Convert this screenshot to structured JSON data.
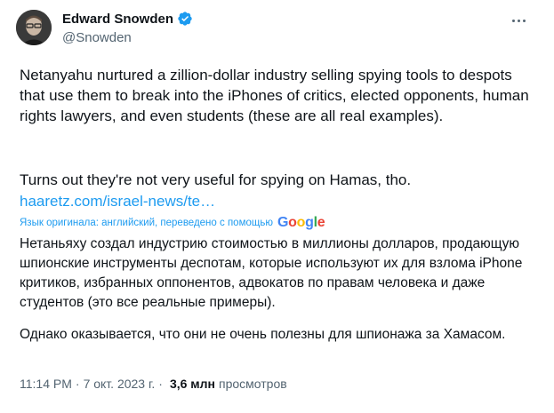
{
  "author": {
    "name": "Edward Snowden",
    "handle": "@Snowden",
    "verified": true,
    "avatar_icon": "person-avatar"
  },
  "menu_icon": "more-horizontal-icon",
  "tweet": {
    "text_p1": "Netanyahu nurtured a zillion-dollar industry selling spying tools to despots that use them to break into the iPhones of critics, elected opponents, human rights lawyers, and even students (these are all real examples).",
    "text_p2": "Turns out they're not very useful for spying on Hamas, tho.",
    "link": "haaretz.com/israel-news/te…"
  },
  "translation": {
    "notice": "Язык оригинала: английский, переведено с помощью",
    "provider": "Google",
    "text_p1": "Нетаньяху создал индустрию стоимостью в миллионы долларов, продающую шпионские инструменты деспотам, которые используют их для взлома iPhone критиков, избранных оппонентов, адвокатов по правам человека и даже студентов (это все реальные примеры).",
    "text_p2": "Однако оказывается, что они не очень полезны для шпионажа за Хамасом."
  },
  "meta": {
    "time": "11:14 PM",
    "separator": "·",
    "date": "7 окт. 2023 г.",
    "views_count": "3,6 млн",
    "views_label": "просмотров"
  },
  "colors": {
    "text": "#0f1419",
    "secondary": "#536471",
    "link": "#1d9bf0",
    "verified": "#1d9bf0"
  }
}
